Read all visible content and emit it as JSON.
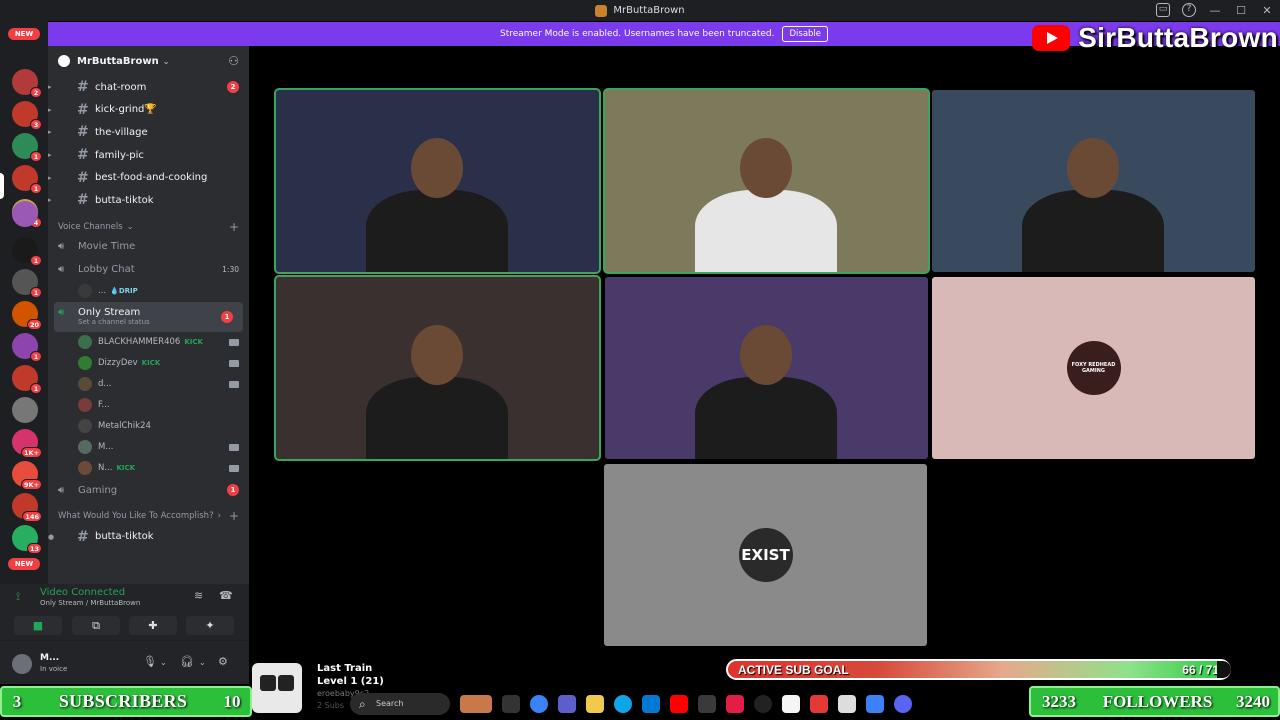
{
  "window": {
    "title": "MrButtaBrown",
    "controls": [
      "—",
      "☐",
      "✕"
    ]
  },
  "banner": {
    "message": "Streamer Mode is enabled. Usernames have been truncated.",
    "button": "Disable"
  },
  "youtube_overlay": {
    "channel": "SirButtaBrown"
  },
  "rail": {
    "servers": [
      {
        "badge": "NEW",
        "color": "#f23f43"
      },
      {
        "badge": "2",
        "color": "#b23a3a"
      },
      {
        "badge": "3",
        "color": "#c0392b"
      },
      {
        "badge": "1",
        "color": "#2e8b57"
      },
      {
        "badge": "1",
        "color": "#c0392b"
      },
      {
        "badge": "4",
        "color": "#caa34a"
      },
      {
        "badge": "",
        "color": "#9b59b6"
      },
      {
        "badge": "1",
        "color": "#1a1a1a"
      },
      {
        "badge": "1",
        "color": "#555555"
      },
      {
        "badge": "20",
        "color": "#d35400"
      },
      {
        "badge": "1",
        "color": "#8e44ad"
      },
      {
        "badge": "1",
        "color": "#c0392b"
      },
      {
        "badge": "",
        "color": "#777777"
      },
      {
        "badge": "1K+",
        "color": "#d6336c"
      },
      {
        "badge": "9K+",
        "color": "#e74c3c"
      },
      {
        "badge": "146",
        "color": "#c0392b"
      },
      {
        "badge": "13",
        "color": "#27ae60"
      },
      {
        "badge": "NEW",
        "color": "#f23f43"
      }
    ]
  },
  "sidebar": {
    "server_name": "MrButtaBrown",
    "text_channels": [
      {
        "name": "chat-room",
        "count": "2"
      },
      {
        "name": "kick-grind🏆",
        "count": ""
      },
      {
        "name": "the-village",
        "count": ""
      },
      {
        "name": "family-pic",
        "count": ""
      },
      {
        "name": "best-food-and-cooking",
        "count": ""
      },
      {
        "name": "butta-tiktok",
        "count": ""
      }
    ],
    "voice_category": "Voice Channels",
    "voice_channels": [
      {
        "name": "Movie Time",
        "time": ""
      },
      {
        "name": "Lobby Chat",
        "time": "1:30"
      }
    ],
    "lobby_user": {
      "name": "...",
      "tag": "💧DRIP"
    },
    "active_channel": {
      "name": "Only Stream",
      "status": "Set a channel status",
      "count": "1"
    },
    "members": [
      {
        "name": "BLACKHAMMER406",
        "tag": "KICK",
        "av": "#3b6e4d",
        "cam": true
      },
      {
        "name": "DizzyDev",
        "tag": "KICK",
        "av": "#2e7d32",
        "cam": true
      },
      {
        "name": "d...",
        "tag": "",
        "av": "#5a4a3a",
        "cam": true
      },
      {
        "name": "F...",
        "tag": "",
        "av": "#7a3b3b",
        "cam": false
      },
      {
        "name": "MetalChik24",
        "tag": "",
        "av": "#444444",
        "cam": false
      },
      {
        "name": "M...",
        "tag": "",
        "av": "#556b5f",
        "cam": true
      },
      {
        "name": "N...",
        "tag": "KICK",
        "av": "#6b4a3a",
        "cam": true
      }
    ],
    "gaming": {
      "name": "Gaming",
      "count": "1"
    },
    "category2": "What Would You Like To Accomplish?",
    "bottom_channel": "butta-tiktok"
  },
  "voice_panel": {
    "status": "Video Connected",
    "location": "Only Stream / MrButtaBrown",
    "buttons": [
      "camera-icon",
      "screen-share-icon",
      "activities-icon",
      "soundboard-icon"
    ]
  },
  "user_panel": {
    "name": "M...",
    "status": "In voice"
  },
  "tiles": [
    {
      "name": "tile-1",
      "bg": "#2a2f4a",
      "speaking": true,
      "kind": "video"
    },
    {
      "name": "tile-2",
      "bg": "#7d7a5c",
      "speaking": true,
      "kind": "video"
    },
    {
      "name": "tile-3",
      "bg": "#3a4a5e",
      "speaking": false,
      "kind": "video"
    },
    {
      "name": "tile-4",
      "bg": "#3b3030",
      "speaking": true,
      "kind": "video"
    },
    {
      "name": "tile-5",
      "bg": "#4a3a6a",
      "speaking": false,
      "kind": "video"
    },
    {
      "name": "tile-6",
      "bg": "#d9b8b8",
      "speaking": false,
      "kind": "avatar",
      "avatar_text": "FOXY REDHEAD GAMING"
    },
    {
      "name": "tile-7",
      "bg": "#8a8a8a",
      "speaking": false,
      "kind": "avatar",
      "avatar_text": "EXIST"
    }
  ],
  "overlay": {
    "subscribers": {
      "label": "SUBSCRIBERS",
      "current": "3",
      "goal": "10"
    },
    "followers": {
      "label": "FOLLOWERS",
      "current": "3233",
      "goal": "3240"
    },
    "sub_goal": {
      "label": "ACTIVE SUB GOAL",
      "value": "66 / 71",
      "progress": 0.93
    },
    "music": {
      "title": "Last Train",
      "level": "Level 1  (21)",
      "line3": "eroebaby9c2",
      "line4": "2 Subs"
    }
  },
  "taskbar": {
    "search_placeholder": "Search"
  }
}
